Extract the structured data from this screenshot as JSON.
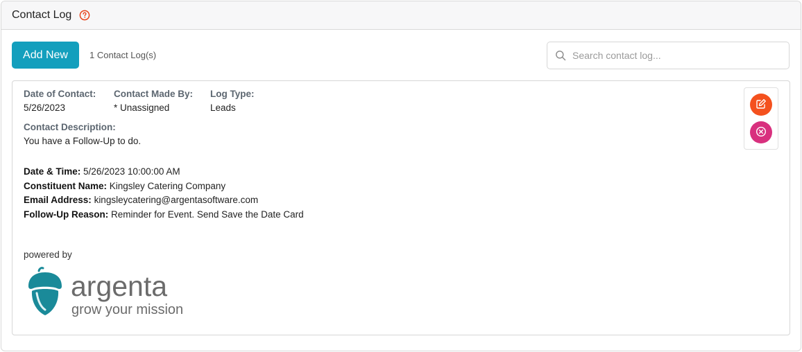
{
  "header": {
    "title": "Contact Log",
    "help_icon": "question-circle-icon"
  },
  "toolbar": {
    "add_label": "Add New",
    "count_text": "1 Contact Log(s)",
    "search_placeholder": "Search contact log...",
    "search_value": ""
  },
  "log": {
    "date_label": "Date of Contact:",
    "date_value": "5/26/2023",
    "made_by_label": "Contact Made By:",
    "made_by_value": "* Unassigned",
    "type_label": "Log Type:",
    "type_value": "Leads",
    "desc_label": "Contact Description:",
    "desc_value": "You have a Follow-Up to do.",
    "details": [
      {
        "label": "Date & Time:",
        "value": "5/26/2023 10:00:00 AM"
      },
      {
        "label": "Constituent Name:",
        "value": "Kingsley Catering Company"
      },
      {
        "label": "Email Address:",
        "value": "kingsleycatering@argentasoftware.com"
      },
      {
        "label": "Follow-Up Reason:",
        "value": "Reminder for Event. Send Save the Date Card"
      }
    ],
    "powered_by": "powered by",
    "logo": {
      "name": "argenta",
      "tagline": "grow your mission"
    }
  },
  "actions": {
    "edit_icon": "edit-icon",
    "delete_icon": "close-circle-icon"
  },
  "colors": {
    "accent": "#139fbd",
    "edit": "#f4511e",
    "delete": "#d8307e",
    "help": "#e8441b",
    "logo_teal": "#1a8a99",
    "logo_gray": "#6b6b6b"
  }
}
